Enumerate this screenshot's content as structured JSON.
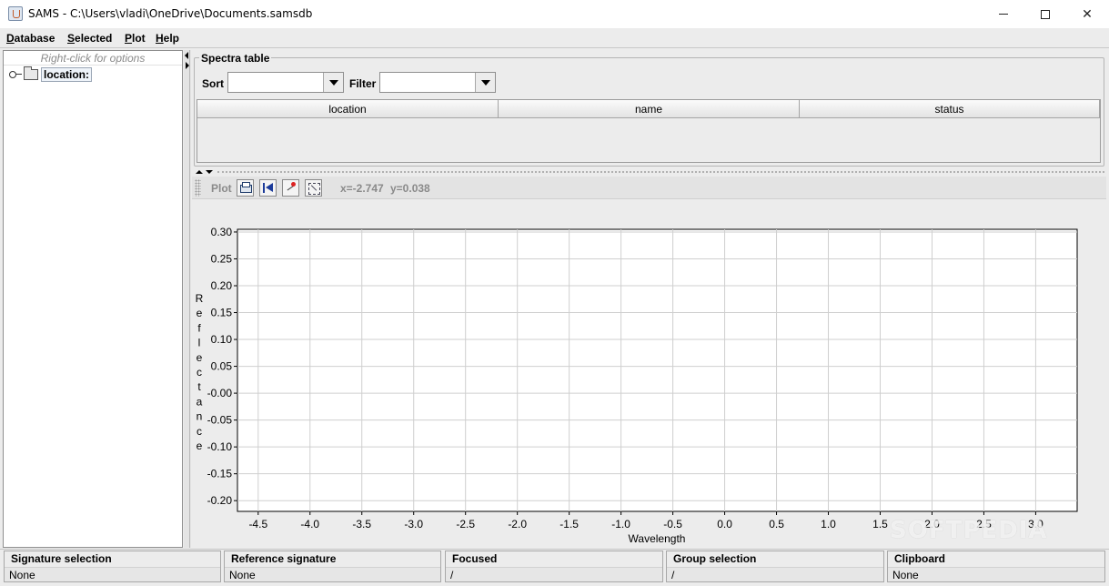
{
  "window": {
    "title": "SAMS - C:\\Users\\vladi\\OneDrive\\Documents.samsdb",
    "minimize": "—",
    "maximize": "☐",
    "close": "✕"
  },
  "menu": [
    {
      "first": "D",
      "rest": "atabase"
    },
    {
      "first": "S",
      "rest": "elected"
    },
    {
      "first": "P",
      "rest": "lot"
    },
    {
      "first": "H",
      "rest": "elp"
    }
  ],
  "tree": {
    "hint": "Right-click for options",
    "root_label": "location:"
  },
  "spectra": {
    "title": "Spectra table",
    "sort_label": "Sort",
    "filter_label": "Filter",
    "sort_value": "",
    "filter_value": "",
    "columns": [
      "location",
      "name",
      "status"
    ]
  },
  "plot_toolbar": {
    "label": "Plot",
    "x_readout": "x=-2.747",
    "y_readout": "y=0.038"
  },
  "chart_data": {
    "type": "line",
    "series": [],
    "xlabel": "Wavelength",
    "ylabel": "Reflectance",
    "xlim": [
      -4.7,
      3.4
    ],
    "ylim": [
      -0.22,
      0.305
    ],
    "x_ticks": [
      -4.5,
      -4.0,
      -3.5,
      -3.0,
      -2.5,
      -2.0,
      -1.5,
      -1.0,
      -0.5,
      0.0,
      0.5,
      1.0,
      1.5,
      2.0,
      2.5,
      3.0
    ],
    "x_tick_labels": [
      "-4.5",
      "-4.0",
      "-3.5",
      "-3.0",
      "-2.5",
      "-2.0",
      "-1.5",
      "-1.0",
      "-0.5",
      "0.0",
      "0.5",
      "1.0",
      "1.5",
      "2.0",
      "2.5",
      "3.0"
    ],
    "y_ticks": [
      0.3,
      0.25,
      0.2,
      0.15,
      0.1,
      0.05,
      0.0,
      -0.05,
      -0.1,
      -0.15,
      -0.2
    ],
    "y_tick_labels": [
      "0.30",
      "0.25",
      "0.20",
      "0.15",
      "0.10",
      "0.05",
      "-0.00",
      "-0.05",
      "-0.10",
      "-0.15",
      "-0.20"
    ],
    "grid": true
  },
  "watermark": "SOFTPEDIA",
  "status": [
    {
      "title": "Signature selection",
      "value": "None"
    },
    {
      "title": "Reference signature",
      "value": "None"
    },
    {
      "title": "Focused",
      "value": "/"
    },
    {
      "title": "Group selection",
      "value": "/"
    },
    {
      "title": "Clipboard",
      "value": "None"
    }
  ]
}
